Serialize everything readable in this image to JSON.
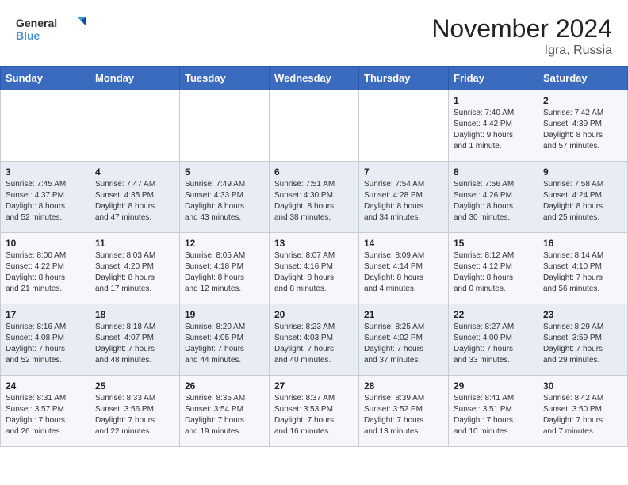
{
  "header": {
    "logo_general": "General",
    "logo_blue": "Blue",
    "month_title": "November 2024",
    "location": "Igra, Russia"
  },
  "weekdays": [
    "Sunday",
    "Monday",
    "Tuesday",
    "Wednesday",
    "Thursday",
    "Friday",
    "Saturday"
  ],
  "weeks": [
    [
      {
        "day": "",
        "info": ""
      },
      {
        "day": "",
        "info": ""
      },
      {
        "day": "",
        "info": ""
      },
      {
        "day": "",
        "info": ""
      },
      {
        "day": "",
        "info": ""
      },
      {
        "day": "1",
        "info": "Sunrise: 7:40 AM\nSunset: 4:42 PM\nDaylight: 9 hours\nand 1 minute."
      },
      {
        "day": "2",
        "info": "Sunrise: 7:42 AM\nSunset: 4:39 PM\nDaylight: 8 hours\nand 57 minutes."
      }
    ],
    [
      {
        "day": "3",
        "info": "Sunrise: 7:45 AM\nSunset: 4:37 PM\nDaylight: 8 hours\nand 52 minutes."
      },
      {
        "day": "4",
        "info": "Sunrise: 7:47 AM\nSunset: 4:35 PM\nDaylight: 8 hours\nand 47 minutes."
      },
      {
        "day": "5",
        "info": "Sunrise: 7:49 AM\nSunset: 4:33 PM\nDaylight: 8 hours\nand 43 minutes."
      },
      {
        "day": "6",
        "info": "Sunrise: 7:51 AM\nSunset: 4:30 PM\nDaylight: 8 hours\nand 38 minutes."
      },
      {
        "day": "7",
        "info": "Sunrise: 7:54 AM\nSunset: 4:28 PM\nDaylight: 8 hours\nand 34 minutes."
      },
      {
        "day": "8",
        "info": "Sunrise: 7:56 AM\nSunset: 4:26 PM\nDaylight: 8 hours\nand 30 minutes."
      },
      {
        "day": "9",
        "info": "Sunrise: 7:58 AM\nSunset: 4:24 PM\nDaylight: 8 hours\nand 25 minutes."
      }
    ],
    [
      {
        "day": "10",
        "info": "Sunrise: 8:00 AM\nSunset: 4:22 PM\nDaylight: 8 hours\nand 21 minutes."
      },
      {
        "day": "11",
        "info": "Sunrise: 8:03 AM\nSunset: 4:20 PM\nDaylight: 8 hours\nand 17 minutes."
      },
      {
        "day": "12",
        "info": "Sunrise: 8:05 AM\nSunset: 4:18 PM\nDaylight: 8 hours\nand 12 minutes."
      },
      {
        "day": "13",
        "info": "Sunrise: 8:07 AM\nSunset: 4:16 PM\nDaylight: 8 hours\nand 8 minutes."
      },
      {
        "day": "14",
        "info": "Sunrise: 8:09 AM\nSunset: 4:14 PM\nDaylight: 8 hours\nand 4 minutes."
      },
      {
        "day": "15",
        "info": "Sunrise: 8:12 AM\nSunset: 4:12 PM\nDaylight: 8 hours\nand 0 minutes."
      },
      {
        "day": "16",
        "info": "Sunrise: 8:14 AM\nSunset: 4:10 PM\nDaylight: 7 hours\nand 56 minutes."
      }
    ],
    [
      {
        "day": "17",
        "info": "Sunrise: 8:16 AM\nSunset: 4:08 PM\nDaylight: 7 hours\nand 52 minutes."
      },
      {
        "day": "18",
        "info": "Sunrise: 8:18 AM\nSunset: 4:07 PM\nDaylight: 7 hours\nand 48 minutes."
      },
      {
        "day": "19",
        "info": "Sunrise: 8:20 AM\nSunset: 4:05 PM\nDaylight: 7 hours\nand 44 minutes."
      },
      {
        "day": "20",
        "info": "Sunrise: 8:23 AM\nSunset: 4:03 PM\nDaylight: 7 hours\nand 40 minutes."
      },
      {
        "day": "21",
        "info": "Sunrise: 8:25 AM\nSunset: 4:02 PM\nDaylight: 7 hours\nand 37 minutes."
      },
      {
        "day": "22",
        "info": "Sunrise: 8:27 AM\nSunset: 4:00 PM\nDaylight: 7 hours\nand 33 minutes."
      },
      {
        "day": "23",
        "info": "Sunrise: 8:29 AM\nSunset: 3:59 PM\nDaylight: 7 hours\nand 29 minutes."
      }
    ],
    [
      {
        "day": "24",
        "info": "Sunrise: 8:31 AM\nSunset: 3:57 PM\nDaylight: 7 hours\nand 26 minutes."
      },
      {
        "day": "25",
        "info": "Sunrise: 8:33 AM\nSunset: 3:56 PM\nDaylight: 7 hours\nand 22 minutes."
      },
      {
        "day": "26",
        "info": "Sunrise: 8:35 AM\nSunset: 3:54 PM\nDaylight: 7 hours\nand 19 minutes."
      },
      {
        "day": "27",
        "info": "Sunrise: 8:37 AM\nSunset: 3:53 PM\nDaylight: 7 hours\nand 16 minutes."
      },
      {
        "day": "28",
        "info": "Sunrise: 8:39 AM\nSunset: 3:52 PM\nDaylight: 7 hours\nand 13 minutes."
      },
      {
        "day": "29",
        "info": "Sunrise: 8:41 AM\nSunset: 3:51 PM\nDaylight: 7 hours\nand 10 minutes."
      },
      {
        "day": "30",
        "info": "Sunrise: 8:42 AM\nSunset: 3:50 PM\nDaylight: 7 hours\nand 7 minutes."
      }
    ]
  ]
}
